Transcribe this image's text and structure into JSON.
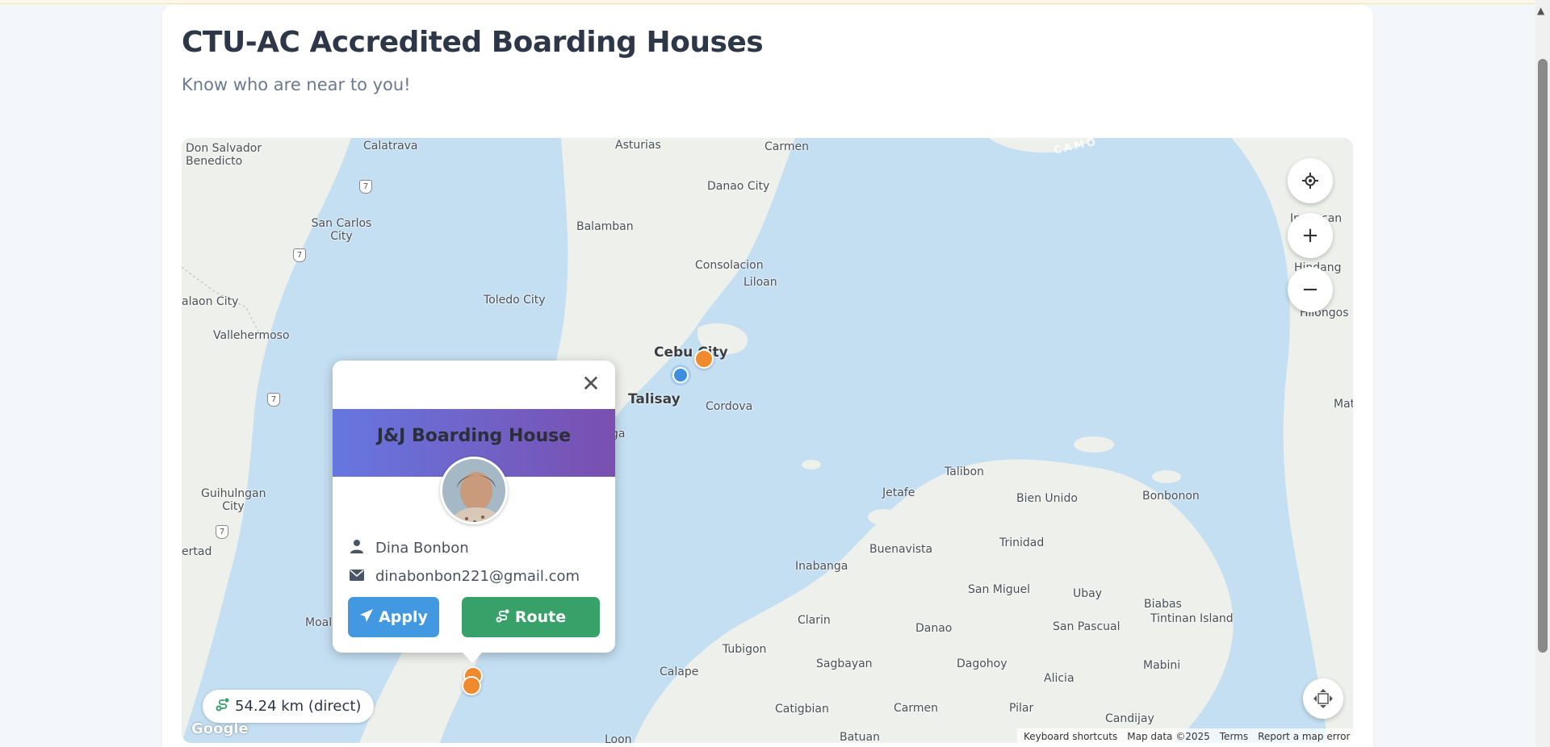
{
  "header": {
    "title": "CTU-AC Accredited Boarding Houses",
    "subtitle": "Know who are near to you!"
  },
  "map": {
    "places": [
      {
        "name": "Don Salvador Benedicto",
        "id": "don-salvador"
      },
      {
        "name": "Calatrava",
        "id": "calatrava"
      },
      {
        "name": "Asturias",
        "id": "asturias"
      },
      {
        "name": "Carmen",
        "id": "carmen-north"
      },
      {
        "name": "Danao City",
        "id": "danao-city"
      },
      {
        "name": "San Carlos City",
        "id": "san-carlos"
      },
      {
        "name": "Balamban",
        "id": "balamban"
      },
      {
        "name": "Consolacion",
        "id": "consolacion"
      },
      {
        "name": "Liloan",
        "id": "liloan"
      },
      {
        "name": "alaon City",
        "id": "canlaon"
      },
      {
        "name": "Toledo City",
        "id": "toledo"
      },
      {
        "name": "Vallehermoso",
        "id": "vallehermoso"
      },
      {
        "name": "Cebu City",
        "id": "cebu-city"
      },
      {
        "name": "Talisay",
        "id": "talisay"
      },
      {
        "name": "Cordova",
        "id": "cordova"
      },
      {
        "name": "ga",
        "id": "minglanilla-fragment"
      },
      {
        "name": "Talibon",
        "id": "talibon"
      },
      {
        "name": "Jetafe",
        "id": "jetafe"
      },
      {
        "name": "Bien Unido",
        "id": "bien-unido"
      },
      {
        "name": "Bonbonon",
        "id": "bonbonon"
      },
      {
        "name": "Guihulngan City",
        "id": "guihulngan"
      },
      {
        "name": "Buenavista",
        "id": "buenavista"
      },
      {
        "name": "Trinidad",
        "id": "trinidad"
      },
      {
        "name": "ertad",
        "id": "libertad"
      },
      {
        "name": "Inabanga",
        "id": "inabanga"
      },
      {
        "name": "San Miguel",
        "id": "san-miguel"
      },
      {
        "name": "Ubay",
        "id": "ubay"
      },
      {
        "name": "Biabas",
        "id": "biabas"
      },
      {
        "name": "Tintinan Island",
        "id": "tintinan"
      },
      {
        "name": "Clarin",
        "id": "clarin"
      },
      {
        "name": "Danao",
        "id": "danao"
      },
      {
        "name": "San Pascual",
        "id": "san-pascual"
      },
      {
        "name": "Moal",
        "id": "moal"
      },
      {
        "name": "Tubigon",
        "id": "tubigon"
      },
      {
        "name": "Sagbayan",
        "id": "sagbayan"
      },
      {
        "name": "Dagohoy",
        "id": "dagohoy"
      },
      {
        "name": "Mabini",
        "id": "mabini"
      },
      {
        "name": "Calape",
        "id": "calape"
      },
      {
        "name": "Alicia",
        "id": "alicia"
      },
      {
        "name": "Catigbian",
        "id": "catigbian"
      },
      {
        "name": "Carmen",
        "id": "carmen-south"
      },
      {
        "name": "Pilar",
        "id": "pilar"
      },
      {
        "name": "Candijay",
        "id": "candijay"
      },
      {
        "name": "Batuan",
        "id": "batuan"
      },
      {
        "name": "Loon",
        "id": "loon"
      },
      {
        "name": "Hilongos",
        "id": "hilongos"
      },
      {
        "name": "Hindang",
        "id": "hindang"
      },
      {
        "name": "Inopacan",
        "id": "inopacan"
      },
      {
        "name": "Mat",
        "id": "matalom"
      },
      {
        "name": "CAMO",
        "id": "camotes-sea"
      }
    ],
    "road_shields": [
      "7",
      "7",
      "7",
      "7"
    ],
    "controls": {
      "locate_icon": "crosshair-icon",
      "zoom_in": "+",
      "zoom_out": "−",
      "fullscreen_icon": "fullscreen-icon"
    },
    "attribution": {
      "shortcuts": "Keyboard shortcuts",
      "map_data": "Map data ©2025",
      "terms": "Terms",
      "report": "Report a map error"
    },
    "google_logo": "Google"
  },
  "popup": {
    "close": "✕",
    "title": "J&J Boarding House",
    "owner_name": "Dina Bonbon",
    "email": "dinabonbon221@gmail.com",
    "apply_label": "Apply",
    "route_label": "Route"
  },
  "distance": {
    "label": "54.24 km (direct)"
  },
  "colors": {
    "accent_blue": "#4299e1",
    "accent_green": "#38a169",
    "marker_orange": "#f08a2c",
    "header_gradient_start": "#6677e0",
    "header_gradient_end": "#7a4fb0"
  }
}
